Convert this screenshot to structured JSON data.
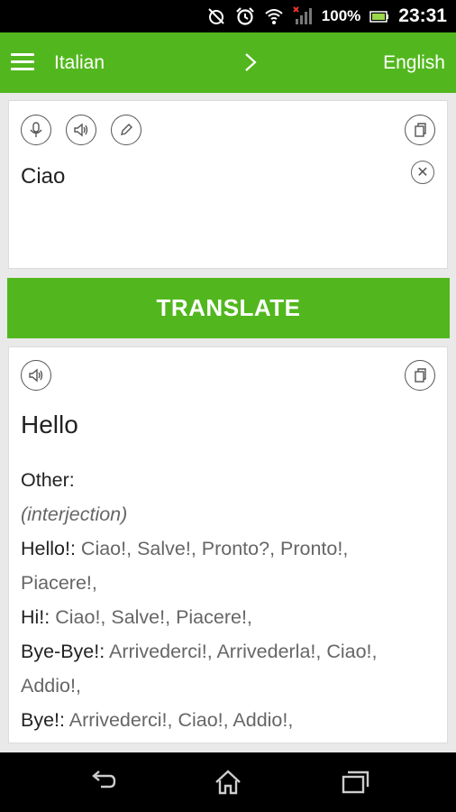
{
  "status_bar": {
    "battery_percent": "100%",
    "time": "23:31"
  },
  "app_bar": {
    "source_language": "Italian",
    "target_language": "English"
  },
  "input": {
    "text": "Ciao"
  },
  "translate_button": {
    "label": "TRANSLATE"
  },
  "output": {
    "main_translation": "Hello",
    "other_label": "Other:",
    "part_of_speech": "(interjection)",
    "entries": [
      {
        "term": "Hello!:",
        "synonyms": " Ciao!, Salve!, Pronto?, Pronto!,",
        "synonyms_cont": "Piacere!,"
      },
      {
        "term": "Hi!:",
        "synonyms": " Ciao!, Salve!, Piacere!,"
      },
      {
        "term": "Bye-Bye!:",
        "synonyms": " Arrivederci!, Arrivederla!, Ciao!,",
        "synonyms_cont": "Addio!,"
      },
      {
        "term": "Bye!:",
        "synonyms": " Arrivederci!, Ciao!, Addio!,"
      }
    ]
  },
  "colors": {
    "accent": "#52b71e",
    "status_bar": "#000000",
    "nav_bar": "#000000"
  },
  "icons": [
    "alarm-off-icon",
    "alarm-clock-icon",
    "wifi-icon",
    "signal-icon",
    "battery-icon",
    "menu-icon",
    "chevron-right-icon",
    "microphone-icon",
    "speaker-icon",
    "pencil-icon",
    "copy-icon",
    "close-icon",
    "back-icon",
    "home-icon",
    "recent-apps-icon"
  ]
}
